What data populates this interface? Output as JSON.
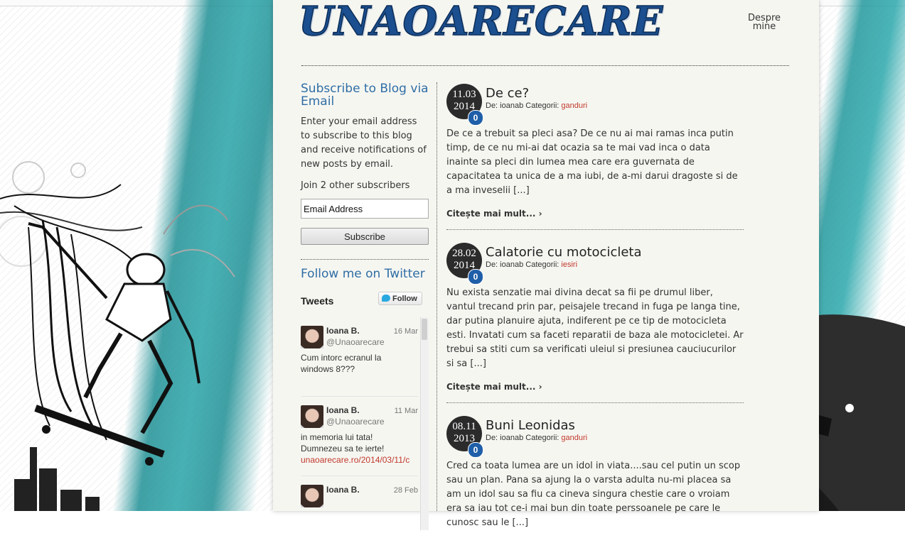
{
  "site": {
    "logo": "UNAOARECARE",
    "nav_about": "Despre mine"
  },
  "sidebar": {
    "subscribe_title": "Subscribe to Blog via Email",
    "subscribe_text": "Enter your email address to subscribe to this blog and receive notifications of new posts by email.",
    "subscribers_text": "Join 2 other subscribers",
    "email_value": "Email Address",
    "subscribe_button": "Subscribe",
    "twitter_title": "Follow me on Twitter",
    "tweets_label": "Tweets",
    "follow_button": "Follow",
    "tweets": [
      {
        "name": "Ioana B.",
        "handle": "@Unaoarecare",
        "date": "16 Mar",
        "text": "Cum intorc ecranul la windows 8???",
        "link": ""
      },
      {
        "name": "Ioana B.",
        "handle": "@Unaoarecare",
        "date": "11 Mar",
        "text": "in memoria lui tata! Dumnezeu sa te ierte!",
        "link": "unaoarecare.ro/2014/03/11/c"
      },
      {
        "name": "Ioana B.",
        "handle": "",
        "date": "28 Feb",
        "text": "",
        "link": ""
      }
    ]
  },
  "posts": [
    {
      "date_day": "11.03",
      "date_year": "2014",
      "comments": "0",
      "title": "De ce?",
      "meta_prefix": "De: ioanab Categorii:",
      "category": "ganduri",
      "excerpt": "De ce a trebuit sa pleci asa? De ce nu ai mai ramas inca putin timp, de ce nu mi-ai dat ocazia sa te mai vad inca o data inainte sa pleci din lumea mea care era guvernata de capacitatea ta unica de a ma iubi, de a-mi darui dragoste si de a ma inveselii [...]",
      "more": "Citește mai mult... ›"
    },
    {
      "date_day": "28.02",
      "date_year": "2014",
      "comments": "0",
      "title": "Calatorie cu motocicleta",
      "meta_prefix": "De: ioanab Categorii:",
      "category": "iesiri",
      "excerpt": "Nu exista senzatie mai divina decat sa fii pe drumul liber, vantul trecand prin par, peisajele trecand in fuga pe langa tine, dar putina planuire ajuta, indiferent pe ce tip de motocicleta esti. Invatati cum sa faceti reparatii de baza ale motocicletei. Ar trebui sa stiti cum sa verificati uleiul si presiunea cauciucurilor si sa [...]",
      "more": "Citește mai mult... ›"
    },
    {
      "date_day": "08.11",
      "date_year": "2013",
      "comments": "0",
      "title": "Buni Leonidas",
      "meta_prefix": "De: ioanab Categorii:",
      "category": "ganduri",
      "excerpt": "Cred ca toata lumea are un idol in viata....sau cel putin un scop sau un plan. Pana sa ajung la o varsta adulta nu-mi placea sa am un idol sau sa fiu ca cineva singura chestie care o vroiam era sa iau tot ce-i mai bun din toate perssoanele pe care le cunosc sau le [...]",
      "more": ""
    }
  ]
}
